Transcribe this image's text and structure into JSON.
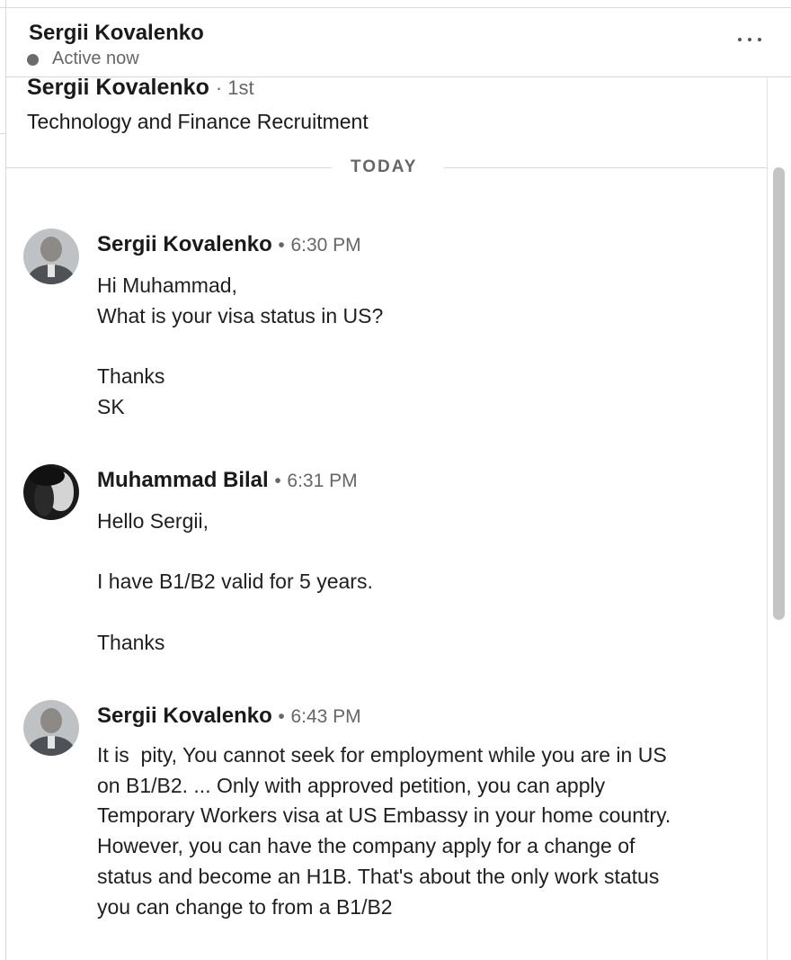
{
  "header": {
    "name": "Sergii Kovalenko",
    "status": "Active now",
    "more_label": "..."
  },
  "profile": {
    "name": "Sergii Kovalenko",
    "degree": "· 1st",
    "headline": "Technology and Finance Recruitment"
  },
  "divider": {
    "label": "TODAY"
  },
  "messages": [
    {
      "sender": "Sergii Kovalenko",
      "separator": "•",
      "time": "6:30 PM",
      "lines": [
        "Hi Muhammad,",
        "What is your visa status in US?",
        "",
        "Thanks",
        "SK"
      ]
    },
    {
      "sender": "Muhammad Bilal",
      "separator": "•",
      "time": "6:31 PM",
      "lines": [
        "Hello Sergii,",
        "",
        "I have B1/B2 valid for 5 years.",
        "",
        "Thanks"
      ]
    },
    {
      "sender": "Sergii Kovalenko",
      "separator": "•",
      "time": "6:43 PM",
      "lines": [
        "It is  pity, You cannot seek for employment while you are in US",
        "on B1/B2. ... Only with approved petition, you can apply",
        "Temporary Workers visa at US Embassy in your home country.",
        "However, you can have the company apply for a change of",
        "status and become an H1B. That's about the only work status",
        "you can change to from a B1/B2"
      ]
    }
  ],
  "colors": {
    "presence_dot": "#6b6b6b",
    "divider": "#d9d9d9",
    "meta_text": "#666666"
  }
}
